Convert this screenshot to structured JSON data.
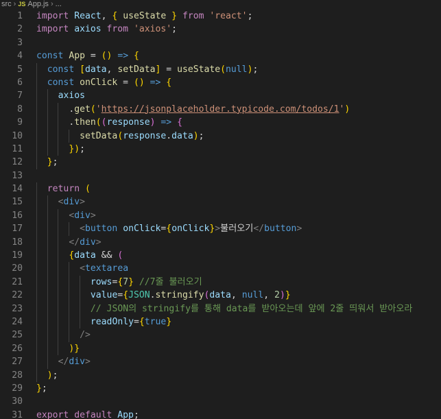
{
  "breadcrumb": {
    "folder": "src",
    "file_badge": "JS",
    "file": "App.js",
    "ellipsis": "..."
  },
  "code_lines": [
    {
      "n": "1",
      "text": "import React, { useState } from 'react';"
    },
    {
      "n": "2",
      "text": "import axios from 'axios';"
    },
    {
      "n": "3",
      "text": ""
    },
    {
      "n": "4",
      "text": "const App = () => {"
    },
    {
      "n": "5",
      "text": "  const [data, setData] = useState(null);"
    },
    {
      "n": "6",
      "text": "  const onClick = () => {"
    },
    {
      "n": "7",
      "text": "    axios"
    },
    {
      "n": "8",
      "text": "      .get('https://jsonplaceholder.typicode.com/todos/1')"
    },
    {
      "n": "9",
      "text": "      .then((response) => {"
    },
    {
      "n": "10",
      "text": "        setData(response.data);"
    },
    {
      "n": "11",
      "text": "      });"
    },
    {
      "n": "12",
      "text": "  };"
    },
    {
      "n": "13",
      "text": ""
    },
    {
      "n": "14",
      "text": "  return ("
    },
    {
      "n": "15",
      "text": "    <div>"
    },
    {
      "n": "16",
      "text": "      <div>"
    },
    {
      "n": "17",
      "text": "        <button onClick={onClick}>불러오기</button>"
    },
    {
      "n": "18",
      "text": "      </div>"
    },
    {
      "n": "19",
      "text": "      {data && ("
    },
    {
      "n": "20",
      "text": "        <textarea"
    },
    {
      "n": "21",
      "text": "          rows={7} //7줄 불러오기"
    },
    {
      "n": "22",
      "text": "          value={JSON.stringify(data, null, 2)}"
    },
    {
      "n": "23",
      "text": "          // JSON의 stringify를 통해 data를 받아오는데 앞에 2줄 띄워서 받아오라"
    },
    {
      "n": "24",
      "text": "          readOnly={true}"
    },
    {
      "n": "25",
      "text": "        />"
    },
    {
      "n": "26",
      "text": "      )}"
    },
    {
      "n": "27",
      "text": "    </div>"
    },
    {
      "n": "28",
      "text": "  );"
    },
    {
      "n": "29",
      "text": "};"
    },
    {
      "n": "30",
      "text": ""
    },
    {
      "n": "31",
      "text": "export default App;"
    }
  ],
  "colors": {
    "background": "#1e1e1e",
    "line_number": "#858585",
    "keyword": "#569cd6",
    "control": "#c586c0",
    "variable": "#9cdcfe",
    "function": "#dcdcaa",
    "string": "#ce9178",
    "number": "#b5cea8",
    "comment": "#6a9955",
    "bracket_1": "#ffd700",
    "bracket_2": "#da70d6",
    "bracket_3": "#179fff"
  }
}
